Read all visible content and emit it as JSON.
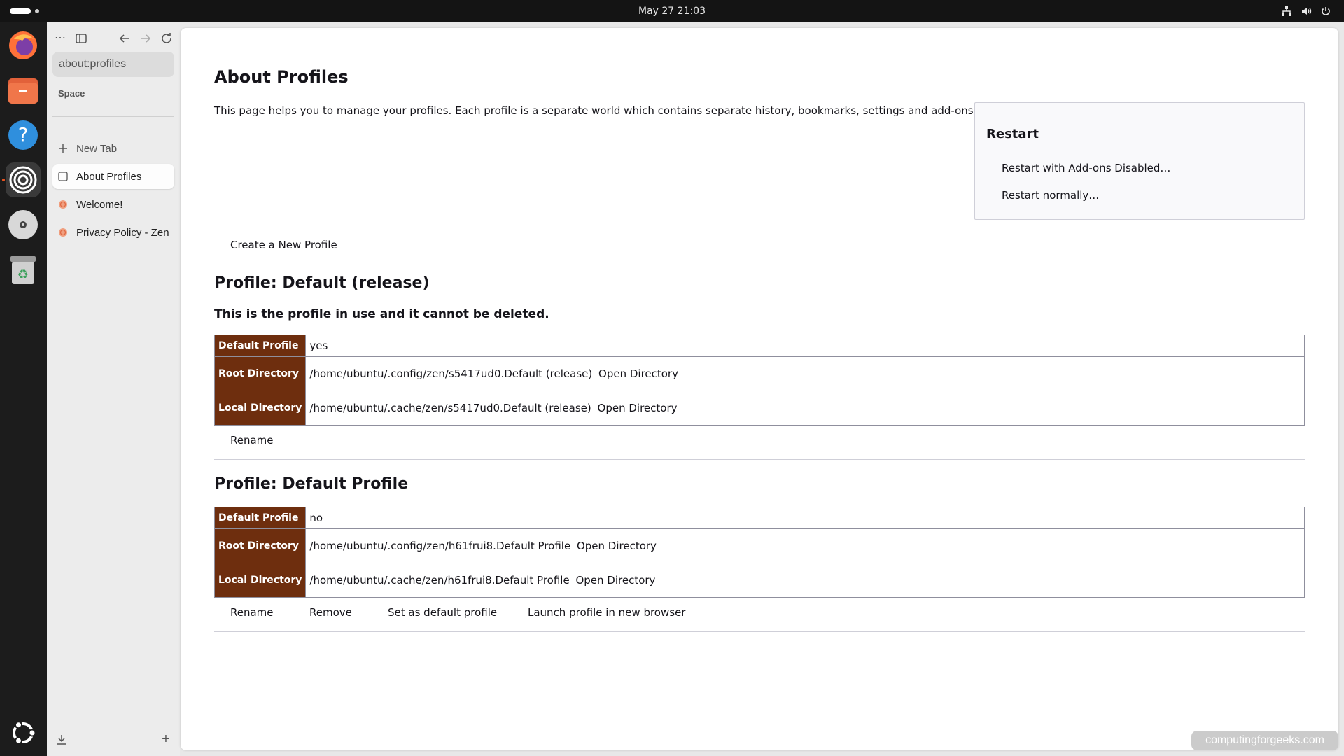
{
  "system": {
    "clock": "May 27  21:03",
    "tray_icons": [
      "network-icon",
      "volume-icon",
      "power-icon"
    ]
  },
  "dock": {
    "apps": [
      "firefox-icon",
      "files-icon",
      "help-icon",
      "zen-browser-icon",
      "disc-icon",
      "trash-icon"
    ],
    "show_apps_icon": "ubuntu-logo-icon"
  },
  "browser": {
    "url": "about:profiles",
    "workspace_label": "Space",
    "new_tab_label": "New Tab",
    "tabs": [
      {
        "label": "About Profiles",
        "selected": true,
        "icon": "page-icon"
      },
      {
        "label": "Welcome!",
        "selected": false,
        "icon": "zen-icon"
      },
      {
        "label": "Privacy Policy - Zen",
        "selected": false,
        "icon": "zen-icon"
      }
    ],
    "colors": {
      "accent": "#e95420",
      "table_header": "#6e2e0e"
    }
  },
  "page": {
    "title": "About Profiles",
    "intro": "This page helps you to manage your profiles. Each profile is a separate world which contains separate history, bookmarks, settings and add-ons.",
    "restart": {
      "title": "Restart",
      "addons_disabled": "Restart with Add-ons Disabled…",
      "normally": "Restart normally…"
    },
    "create_profile": "Create a New Profile",
    "profiles": [
      {
        "heading": "Profile: Default (release)",
        "note": "This is the profile in use and it cannot be deleted.",
        "rows": [
          {
            "label": "Default Profile",
            "value": "yes"
          },
          {
            "label": "Root Directory",
            "value": "/home/ubuntu/.config/zen/s5417ud0.Default (release)",
            "action": "Open Directory"
          },
          {
            "label": "Local Directory",
            "value": "/home/ubuntu/.cache/zen/s5417ud0.Default (release)",
            "action": "Open Directory"
          }
        ],
        "buttons": [
          "Rename"
        ]
      },
      {
        "heading": "Profile: Default Profile",
        "rows": [
          {
            "label": "Default Profile",
            "value": "no"
          },
          {
            "label": "Root Directory",
            "value": "/home/ubuntu/.config/zen/h61frui8.Default Profile",
            "action": "Open Directory"
          },
          {
            "label": "Local Directory",
            "value": "/home/ubuntu/.cache/zen/h61frui8.Default Profile",
            "action": "Open Directory"
          }
        ],
        "buttons": [
          "Rename",
          "Remove",
          "Set as default profile",
          "Launch profile in new browser"
        ]
      }
    ]
  },
  "watermark": "computingforgeeks.com"
}
